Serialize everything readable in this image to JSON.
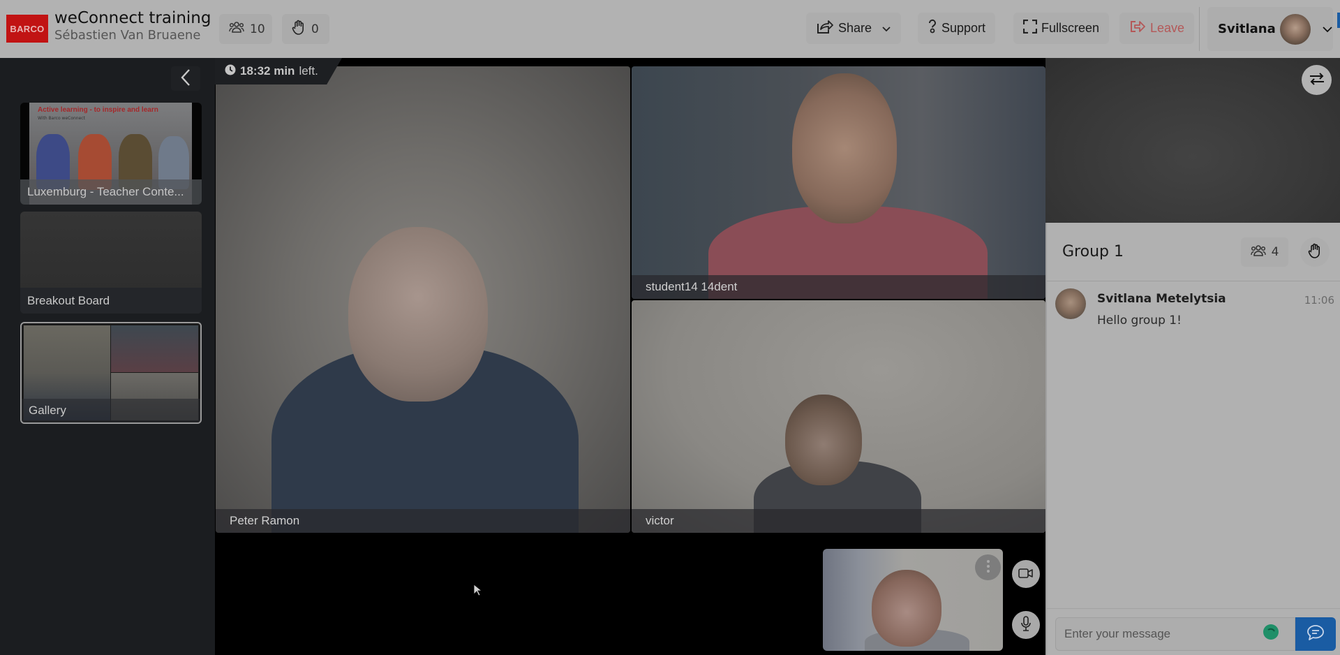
{
  "header": {
    "logo_text": "BARCO",
    "title": "weConnect training",
    "subtitle": "Sébastien Van Bruaene",
    "participants_count": "10",
    "raised_hands_count": "0",
    "share_label": "Share",
    "support_label": "Support",
    "fullscreen_label": "Fullscreen",
    "leave_label": "Leave",
    "user_name": "Svitlana"
  },
  "sidebar": {
    "items": [
      {
        "label": "Luxemburg - Teacher Conte...",
        "slide_title": "Active learning - to inspire and learn",
        "slide_subtitle": "With Barco weConnect"
      },
      {
        "label": "Breakout Board"
      },
      {
        "label": "Gallery"
      }
    ]
  },
  "stage": {
    "timer_value": "18:32 min",
    "timer_suffix": "left.",
    "participants": [
      {
        "name": "Peter Ramon"
      },
      {
        "name": "student14 14dent"
      },
      {
        "name": "victor"
      }
    ]
  },
  "chat": {
    "group_name": "Group 1",
    "member_count": "4",
    "messages": [
      {
        "author": "Svitlana Metelytsia",
        "time": "11:06",
        "text": "Hello group 1!"
      }
    ],
    "input_placeholder": "Enter your message",
    "colors": {
      "send_button": "#1a5ca3",
      "leave_text": "#b45858",
      "brand": "#c11313"
    }
  }
}
